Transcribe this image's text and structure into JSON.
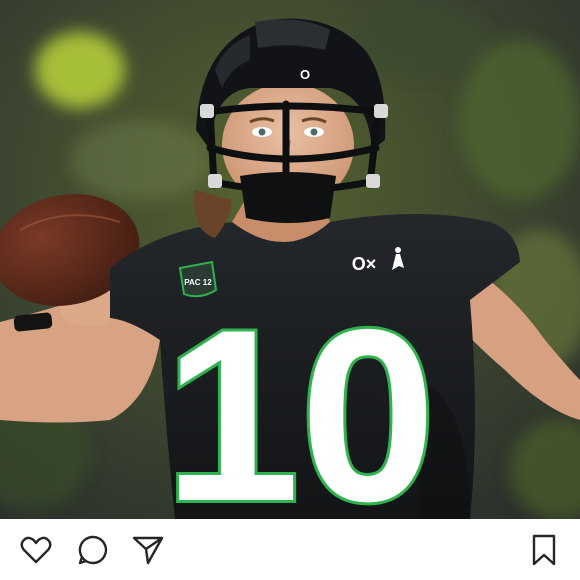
{
  "post": {
    "photo": {
      "jersey_number": "10",
      "helmet_logo": "O",
      "chest_logo": "O×",
      "conference_patch": "PAC 12"
    },
    "actions": {
      "like_icon": "heart-outline-icon",
      "comment_icon": "speech-bubble-icon",
      "share_icon": "paper-plane-icon",
      "save_icon": "bookmark-outline-icon"
    }
  },
  "colors": {
    "jersey": "#17191c",
    "number_fill": "#ffffff",
    "number_outline": "#2fb34f",
    "background_green": "#5f7a2e",
    "icon": "#262626"
  }
}
